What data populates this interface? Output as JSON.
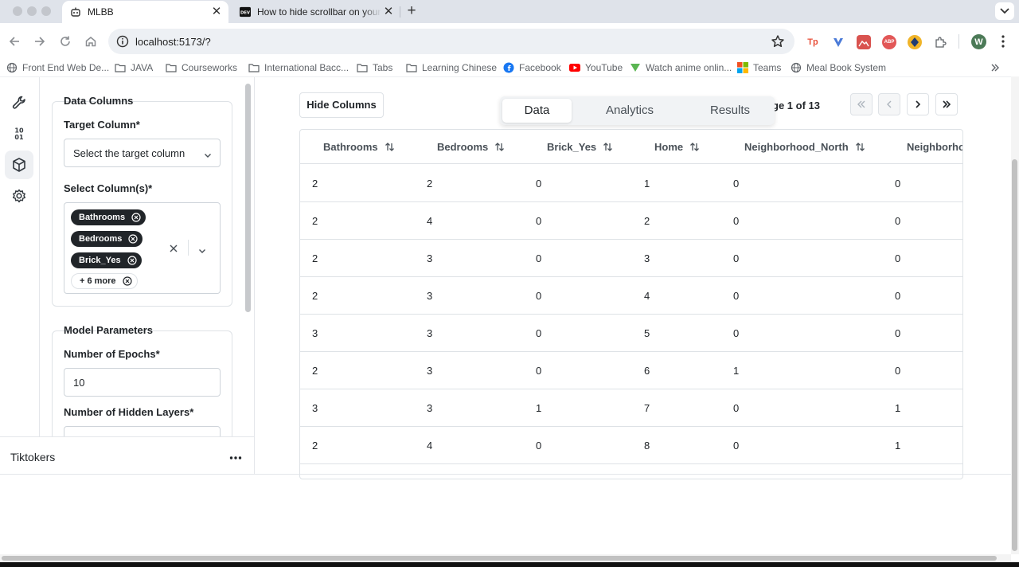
{
  "browser": {
    "tabs": [
      {
        "title": "MLBB",
        "active": true
      },
      {
        "title": "How to hide scrollbar on your",
        "active": false
      }
    ],
    "url": "localhost:5173/?",
    "profile_initial": "W",
    "extensions": [
      {
        "name": "tp-extension-icon",
        "label": "Tp",
        "color": "#e8503a"
      },
      {
        "name": "v-extension-icon",
        "label": "V",
        "color": "#4b7bd8"
      },
      {
        "name": "image-extension-icon",
        "label": "▣",
        "color": "#d9534f"
      },
      {
        "name": "adblock-extension-icon",
        "label": "ABP",
        "color": "#e25757"
      },
      {
        "name": "vpn-extension-icon",
        "label": "◆",
        "color": "#f0b429"
      },
      {
        "name": "puzzle-extensions-icon",
        "label": "",
        "color": "#5f6368"
      }
    ],
    "bookmarks": [
      {
        "label": "Front End Web De...",
        "icon": "globe-icon"
      },
      {
        "label": "JAVA",
        "icon": "folder-icon"
      },
      {
        "label": "Courseworks",
        "icon": "folder-icon"
      },
      {
        "label": "International Bacc...",
        "icon": "folder-icon"
      },
      {
        "label": "Tabs",
        "icon": "folder-icon"
      },
      {
        "label": "Learning Chinese",
        "icon": "folder-icon"
      },
      {
        "label": "Facebook",
        "icon": "facebook-icon"
      },
      {
        "label": "YouTube",
        "icon": "youtube-icon"
      },
      {
        "label": "Watch anime onlin...",
        "icon": "anime-icon"
      },
      {
        "label": "Teams",
        "icon": "teams-icon"
      },
      {
        "label": "Meal Book System",
        "icon": "globe-icon"
      }
    ]
  },
  "rail": {
    "items": [
      "tools-icon",
      "model-icon",
      "dataset-icon",
      "settings-icon"
    ],
    "active_index": 2
  },
  "data_columns": {
    "title": "Data Columns",
    "target_label": "Target Column*",
    "target_placeholder": "Select the target column",
    "select_label": "Select Column(s)*",
    "selected": [
      "Bathrooms",
      "Bedrooms",
      "Brick_Yes"
    ],
    "more_label": "+ 6 more"
  },
  "model_params": {
    "title": "Model Parameters",
    "epochs_label": "Number of Epochs*",
    "epochs_value": "10",
    "hidden_layers_label": "Number of Hidden Layers*"
  },
  "footer_panel": {
    "name": "Tiktokers"
  },
  "main": {
    "hide_columns_label": "Hide Columns",
    "segments": [
      "Data",
      "Analytics",
      "Results"
    ],
    "active_segment": "Data",
    "page_info": "ge 1 of 13",
    "table": {
      "columns": [
        "Bathrooms",
        "Bedrooms",
        "Brick_Yes",
        "Home",
        "Neighborhood_North",
        "Neighborho"
      ],
      "rows": [
        [
          "2",
          "2",
          "0",
          "1",
          "0",
          "0"
        ],
        [
          "2",
          "4",
          "0",
          "2",
          "0",
          "0"
        ],
        [
          "2",
          "3",
          "0",
          "3",
          "0",
          "0"
        ],
        [
          "2",
          "3",
          "0",
          "4",
          "0",
          "0"
        ],
        [
          "3",
          "3",
          "0",
          "5",
          "0",
          "0"
        ],
        [
          "2",
          "3",
          "0",
          "6",
          "1",
          "0"
        ],
        [
          "3",
          "3",
          "1",
          "7",
          "0",
          "1"
        ],
        [
          "2",
          "4",
          "0",
          "8",
          "0",
          "1"
        ]
      ]
    }
  }
}
